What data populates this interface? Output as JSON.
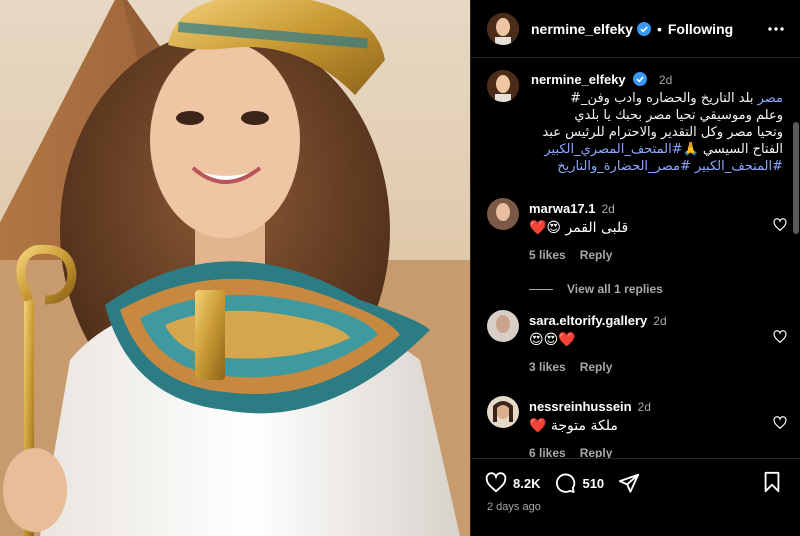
{
  "header": {
    "username": "nermine_elfeky",
    "separator": "•",
    "follow_status": "Following"
  },
  "caption": {
    "username": "nermine_elfeky",
    "time": "2d",
    "line1_tag": "مصر",
    "line1_rest": " بلد التاريخ والحضاره وادب وفن_#",
    "line2": "وعلم وموسيقي تحيا مصر بحبك يا بلدي",
    "line3": "وتحيا مصر وكل التقدير والاحترام للرئيس عبد",
    "line4_plain": "الفتاح السيسي",
    "line4_emoji": "🙏",
    "line4_tag": "#المتحف_المصري_الكبير",
    "line5": "#المتحف_الكبير #مصر_الحضارة_والتاريخ"
  },
  "comments": [
    {
      "username": "marwa17.1",
      "time": "2d",
      "text": "قلبى القمر",
      "emoji": "❤️😍",
      "likes": "5 likes",
      "reply": "Reply",
      "view_replies": "View all 1 replies"
    },
    {
      "username": "sara.eltorify.gallery",
      "time": "2d",
      "text": "",
      "emoji": "😍😍❤️",
      "likes": "3 likes",
      "reply": "Reply"
    },
    {
      "username": "nessreinhussein",
      "time": "2d",
      "text": "ملكة متوجة",
      "emoji": "❤️",
      "likes": "6 likes",
      "reply": "Reply"
    }
  ],
  "actions": {
    "likes_count": "8.2K",
    "comments_count": "510",
    "posted_ago": "2 days ago"
  },
  "colors": {
    "background": "#000000",
    "hashtag": "#8ea8ff",
    "muted": "#a8a8a8",
    "verified": "#3897f0",
    "heart": "#ff3040"
  },
  "icons": [
    "verified-icon",
    "more-icon",
    "heart-icon",
    "comment-icon",
    "share-icon",
    "bookmark-icon"
  ]
}
